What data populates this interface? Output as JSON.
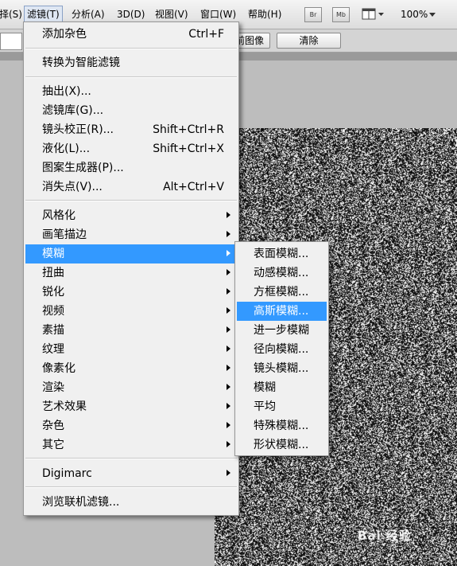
{
  "menubar": {
    "items": [
      "择(S)",
      "滤镜(T)",
      "分析(A)",
      "3D(D)",
      "视图(V)",
      "窗口(W)",
      "帮助(H)"
    ],
    "buttons": [
      "Br",
      "Mb"
    ],
    "zoom": "100%"
  },
  "options_bar": {
    "button1": "前图像",
    "button2": "清除"
  },
  "filter_menu": {
    "last_filter": {
      "label": "添加杂色",
      "shortcut": "Ctrl+F"
    },
    "smart": "转换为智能滤镜",
    "group1": [
      {
        "label": "抽出(X)...",
        "shortcut": ""
      },
      {
        "label": "滤镜库(G)...",
        "shortcut": ""
      },
      {
        "label": "镜头校正(R)...",
        "shortcut": "Shift+Ctrl+R"
      },
      {
        "label": "液化(L)...",
        "shortcut": "Shift+Ctrl+X"
      },
      {
        "label": "图案生成器(P)...",
        "shortcut": ""
      },
      {
        "label": "消失点(V)...",
        "shortcut": "Alt+Ctrl+V"
      }
    ],
    "submenus": [
      "风格化",
      "画笔描边",
      "模糊",
      "扭曲",
      "锐化",
      "视频",
      "素描",
      "纹理",
      "像素化",
      "渲染",
      "艺术效果",
      "杂色",
      "其它"
    ],
    "digimarc": "Digimarc",
    "browse": "浏览联机滤镜..."
  },
  "blur_submenu": {
    "items": [
      "表面模糊...",
      "动感模糊...",
      "方框模糊...",
      "高斯模糊...",
      "进一步模糊",
      "径向模糊...",
      "镜头模糊...",
      "模糊",
      "平均",
      "特殊模糊...",
      "形状模糊..."
    ]
  },
  "watermark": "Bai 经验"
}
